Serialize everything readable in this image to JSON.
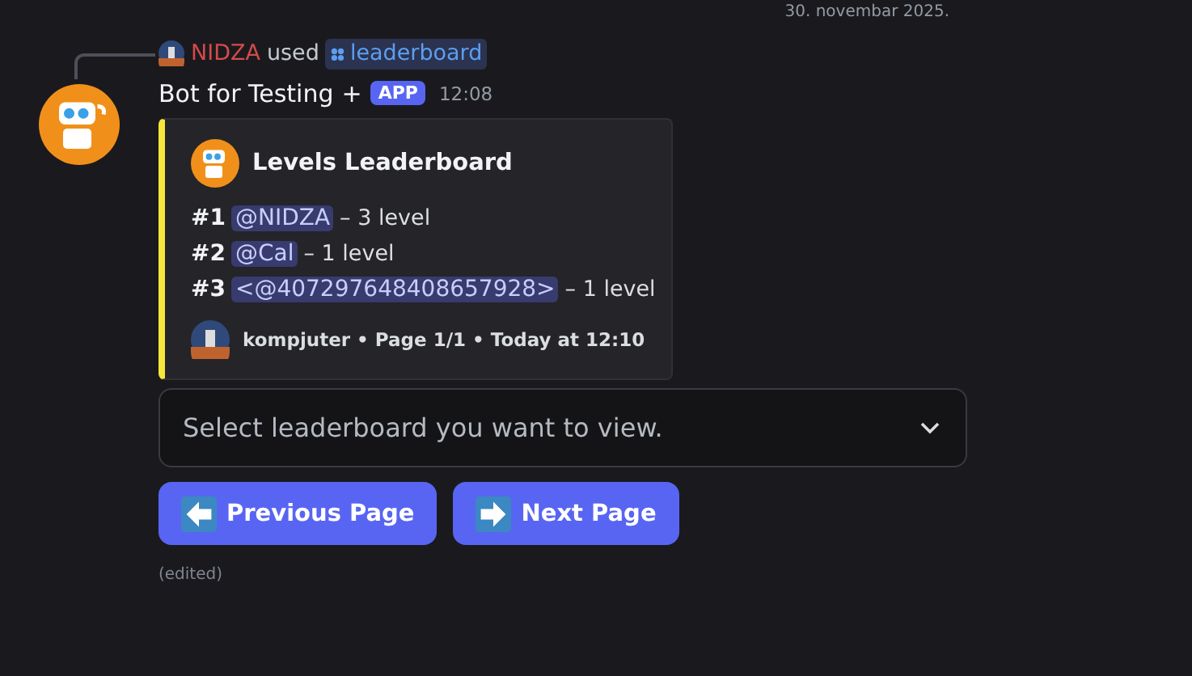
{
  "date_divider": "30. novembar 2025.",
  "reply": {
    "user": "NIDZA",
    "verb": "used",
    "command": "leaderboard"
  },
  "message": {
    "author": "Bot for Testing",
    "plus": "+",
    "tag": "APP",
    "time": "12:08",
    "embed": {
      "title": "Levels Leaderboard",
      "rows": [
        {
          "rank": "#1",
          "mention": "@NIDZA",
          "text": "– 3 level"
        },
        {
          "rank": "#2",
          "mention": "@Cal",
          "text": "– 1 level"
        },
        {
          "rank": "#3",
          "mention": "<@407297648408657928>",
          "text": "– 1 level"
        }
      ],
      "footer": "kompjuter • Page 1/1 • Today at 12:10"
    },
    "select": {
      "placeholder": "Select leaderboard you want to view."
    },
    "buttons": [
      {
        "label": "Previous Page",
        "kind": "prev"
      },
      {
        "label": "Next Page",
        "kind": "next"
      }
    ],
    "edited": "(edited)"
  }
}
